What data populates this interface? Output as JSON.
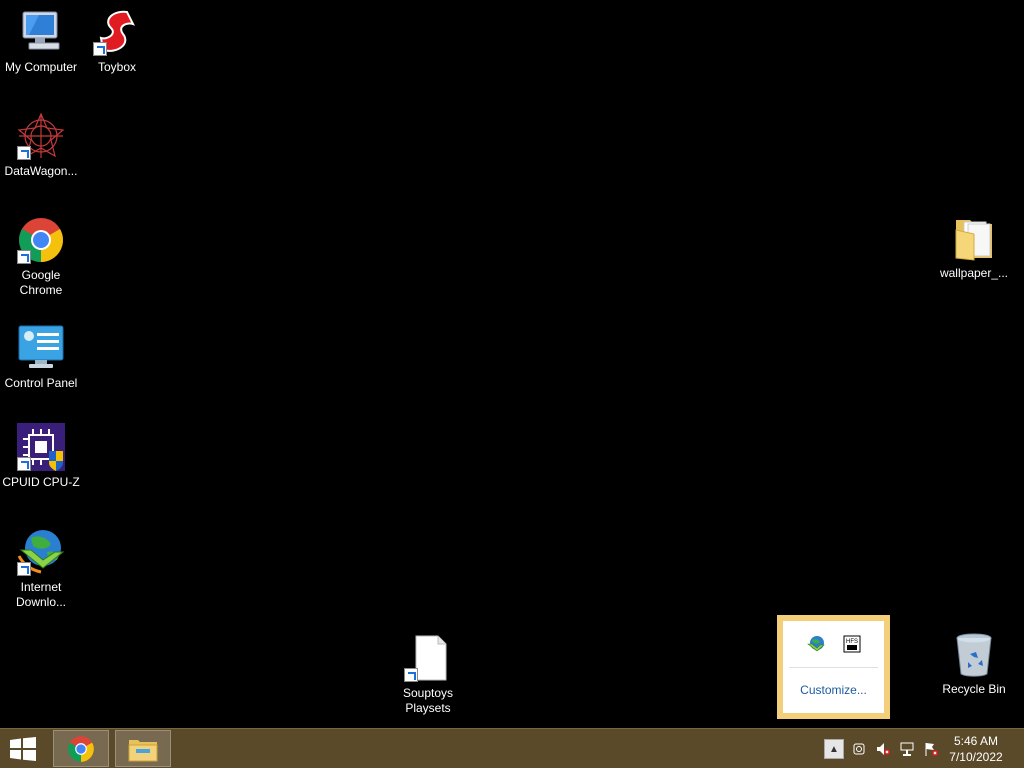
{
  "desktop": {
    "icons": {
      "my_computer": "My Computer",
      "toybox": "Toybox",
      "datawagon": "DataWagon...",
      "chrome_1": "Google",
      "chrome_2": "Chrome",
      "control_panel": "Control Panel",
      "cpuz": "CPUID CPU-Z",
      "idm_1": "Internet",
      "idm_2": "Downlo...",
      "wallpaper": "wallpaper_...",
      "souptoys_1": "Souptoys",
      "souptoys_2": "Playsets",
      "recycle_bin": "Recycle Bin"
    }
  },
  "tray_popup": {
    "customize_label": "Customize...",
    "hfs_badge": "HFS"
  },
  "taskbar": {
    "time": "5:46 AM",
    "date": "7/10/2022",
    "pinned": [
      "chrome-icon",
      "file-explorer-icon"
    ]
  },
  "colors": {
    "taskbar_bg": "#5b4a2a",
    "popup_border": "#f3cf7a",
    "link": "#1c5a9c"
  }
}
